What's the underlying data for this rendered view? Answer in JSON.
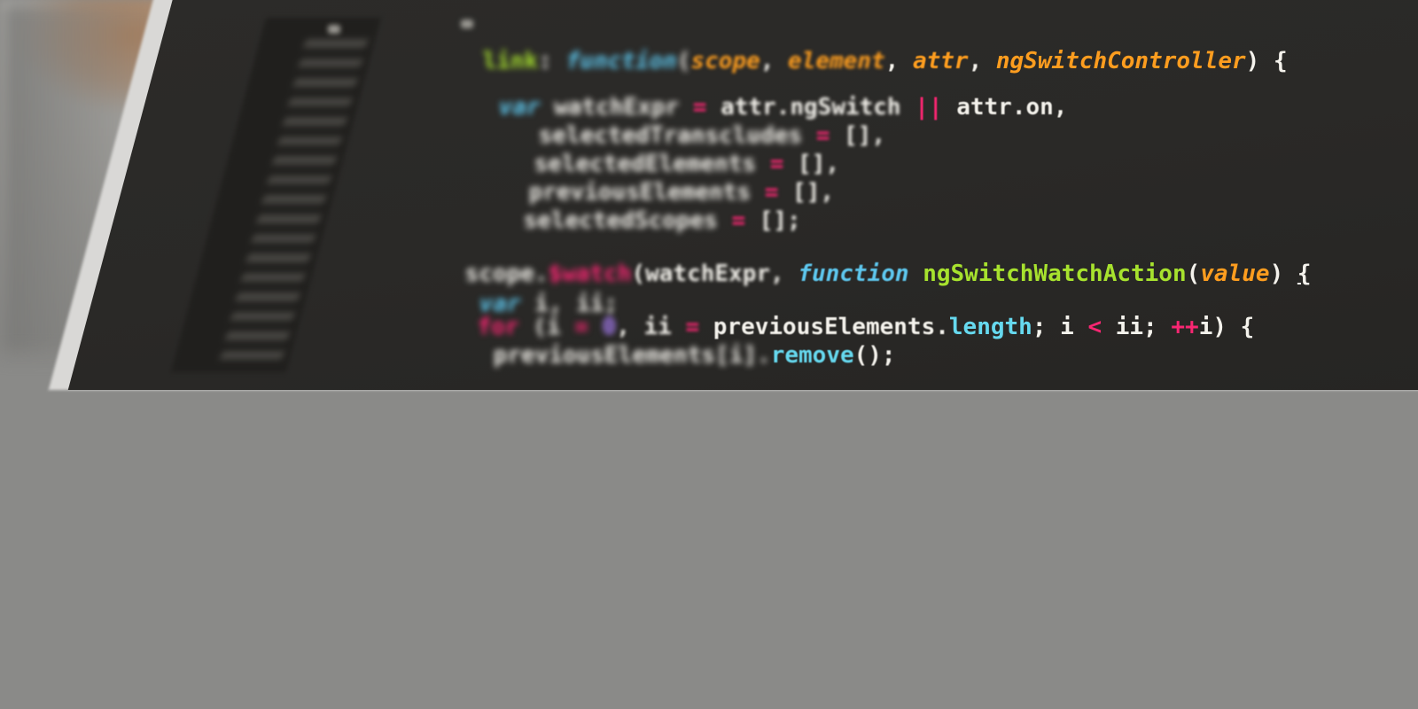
{
  "code_lines": {
    "l1": {
      "kw": "link",
      "colon": ":",
      "fn_kw": "function",
      "open": "(",
      "a1": "scope",
      "c1": ", ",
      "a2": "element",
      "c2": ", ",
      "a3": "attr",
      "c3": ", ",
      "a4": "ngSwitchController",
      "close": ") {"
    },
    "l2": {
      "var": "var",
      "name": " watchExpr ",
      "eq": "=",
      "rest": " attr.ngSwitch ",
      "or": "||",
      "tail": " attr.on,"
    },
    "l3": {
      "name": "selectedTranscludes ",
      "eq": "=",
      "tail": " [],"
    },
    "l4": {
      "name": "selectedElements ",
      "eq": "=",
      "tail": " [],"
    },
    "l5": {
      "name": "previousElements ",
      "eq": "=",
      "tail": " [],"
    },
    "l6": {
      "name": "selectedScopes ",
      "eq": "=",
      "tail": " [];"
    },
    "l7": {
      "obj": "scope.",
      "watch": "$watch",
      "open": "(watchExpr, ",
      "fn_kw": "function",
      "fn": " ngSwitchWatchAction",
      "p_open": "(",
      "arg": "value",
      "p_close": ") ",
      "brace": "{"
    },
    "l8": {
      "var": "var",
      "tail": " i, ii;"
    },
    "l9": {
      "for": "for",
      "open": " (i ",
      "eq": "=",
      "sp": " ",
      "zero": "0",
      "mid": ", ii ",
      "eq2": "=",
      "rest": " previousElements.",
      "len": "length",
      "semi": "; i ",
      "lt": "<",
      "cond": " ii; ",
      "inc": "++",
      "tail": "i) {"
    },
    "l10": {
      "name": "previousElements[i].",
      "remove": "remove",
      "tail": "();"
    }
  },
  "colors": {
    "background": "#2a2927",
    "keyword": "#5ec8ef",
    "function_name": "#a7e22e",
    "argument": "#fd9d1f",
    "operator": "#f92672",
    "number": "#ae81ff",
    "text": "#f4f2ec"
  }
}
